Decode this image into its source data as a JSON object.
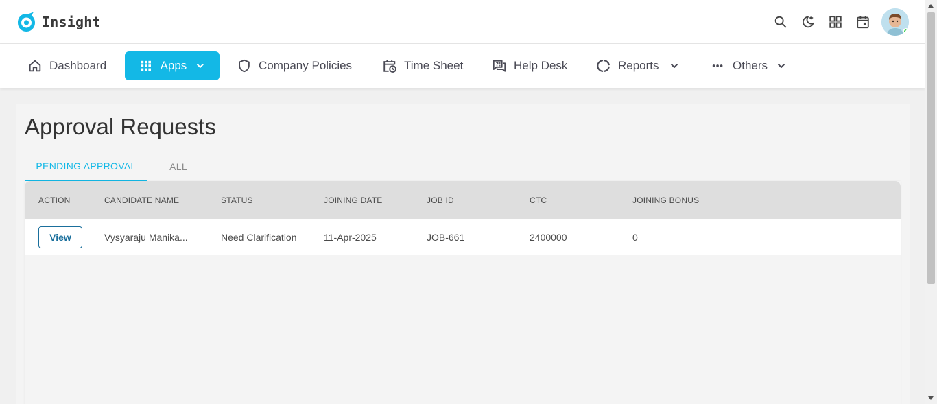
{
  "app": {
    "name": "Insight",
    "brand_color": "#13b8e6"
  },
  "header": {
    "icons": [
      "search-icon",
      "moon-star-icon",
      "grid-icon",
      "calendar-icon"
    ],
    "user": {
      "status": "online",
      "status_color": "#2ecc40"
    }
  },
  "nav": {
    "dashboard": "Dashboard",
    "apps": "Apps",
    "company_policies": "Company Policies",
    "time_sheet": "Time Sheet",
    "help_desk": "Help Desk",
    "reports": "Reports",
    "others": "Others"
  },
  "page": {
    "title": "Approval Requests",
    "tabs": {
      "pending": "PENDING APPROVAL",
      "all": "ALL",
      "active": "pending"
    }
  },
  "table": {
    "columns": [
      "ACTION",
      "CANDIDATE NAME",
      "STATUS",
      "JOINING DATE",
      "JOB ID",
      "CTC",
      "JOINING BONUS"
    ],
    "rows": [
      {
        "action": "View",
        "candidate_name": "Vysyaraju Manika...",
        "status": "Need Clarification",
        "joining_date": "11-Apr-2025",
        "job_id": "JOB-661",
        "ctc": "2400000",
        "joining_bonus": "0"
      }
    ]
  }
}
